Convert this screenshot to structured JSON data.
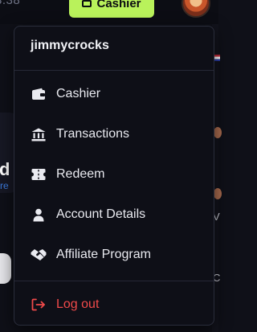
{
  "header": {
    "balance_fragment": "3.38",
    "cashier_label": "Cashier"
  },
  "background": {
    "left_heading_fragment": "d",
    "left_link_fragment": "re"
  },
  "dropdown": {
    "username": "jimmycrocks",
    "items": [
      {
        "label": "Cashier",
        "icon": "wallet-icon"
      },
      {
        "label": "Transactions",
        "icon": "bank-icon"
      },
      {
        "label": "Redeem",
        "icon": "ticket-icon"
      },
      {
        "label": "Account Details",
        "icon": "user-icon"
      },
      {
        "label": "Affiliate Program",
        "icon": "handshake-icon"
      }
    ],
    "logout": {
      "label": "Log out",
      "icon": "logout-icon"
    }
  },
  "colors": {
    "accent": "#b9f25b",
    "danger": "#f04a4a",
    "menu_bg": "#0e0f17",
    "text": "#e9eaf0"
  }
}
